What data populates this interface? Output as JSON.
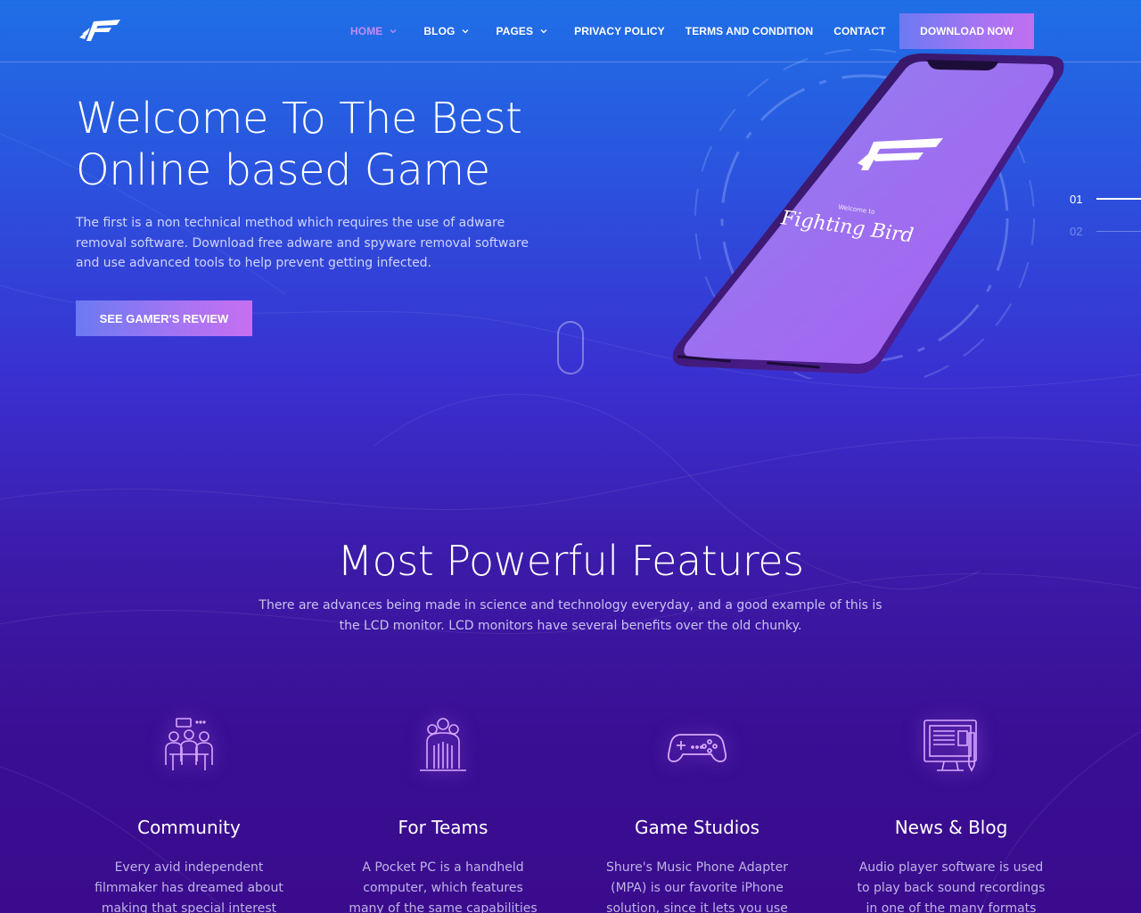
{
  "nav": {
    "items": [
      {
        "label": "HOME",
        "has_dropdown": true,
        "active": true
      },
      {
        "label": "BLOG",
        "has_dropdown": true,
        "active": false
      },
      {
        "label": "PAGES",
        "has_dropdown": true,
        "active": false
      },
      {
        "label": "PRIVACY POLICY",
        "has_dropdown": false,
        "active": false
      },
      {
        "label": "TERMS AND CONDITION",
        "has_dropdown": false,
        "active": false
      },
      {
        "label": "CONTACT",
        "has_dropdown": false,
        "active": false
      }
    ],
    "download_label": "DOWNLOAD NOW"
  },
  "hero": {
    "title_line1": "Welcome To The Best",
    "title_line2": "Online based Game",
    "text": "The first is a non technical method which requires the use of adware removal software. Download free adware and spyware removal software and use advanced tools to help prevent getting infected.",
    "button_label": "SEE GAMER'S REVIEW",
    "phone_screen_small": "Welcome to",
    "phone_screen_title": "Fighting Bird",
    "slides": [
      "01",
      "02"
    ]
  },
  "features": {
    "title": "Most Powerful Features",
    "desc": "There are advances being made in science and technology everyday, and a good example of this is the LCD monitor. LCD monitors have several benefits over the old chunky.",
    "items": [
      {
        "title": "Community",
        "icon": "community-icon",
        "text": "Every avid independent filmmaker has dreamed about making that special interest"
      },
      {
        "title": "For Teams",
        "icon": "teams-icon",
        "text": "A Pocket PC is a handheld computer, which features many of the same capabilities as a"
      },
      {
        "title": "Game Studios",
        "icon": "gamepad-icon",
        "text": "Shure's Music Phone Adapter (MPA) is our favorite iPhone solution, since it lets you use the"
      },
      {
        "title": "News & Blog",
        "icon": "news-icon",
        "text": "Audio player software is used to play back sound recordings in one of the many formats"
      }
    ]
  },
  "colors": {
    "accent": "#c58bf7",
    "button_gradient_start": "#6b7af2",
    "button_gradient_end": "#c06ff0",
    "bg_top": "#1f6fe6",
    "bg_bottom": "#3a0b8c"
  }
}
